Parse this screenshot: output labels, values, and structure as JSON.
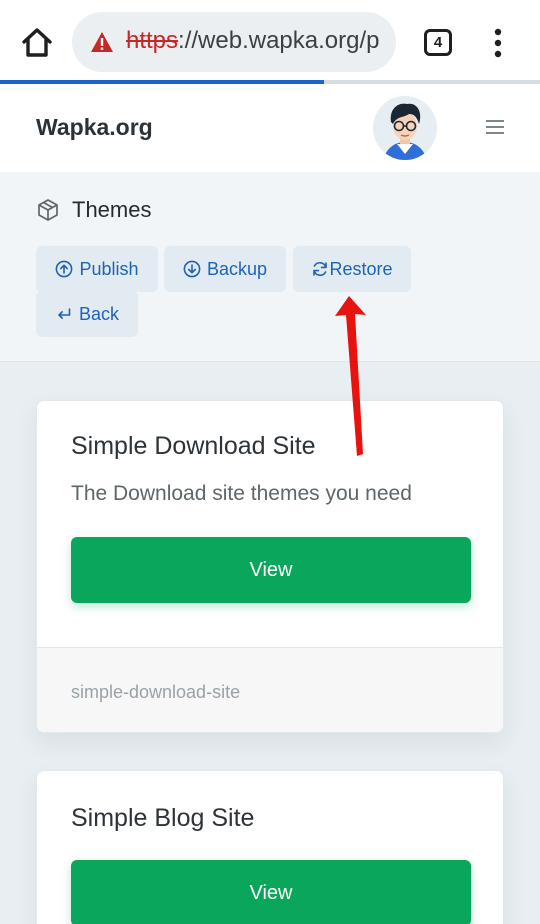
{
  "browser": {
    "url_scheme": "https",
    "url_rest": "://web.wapka.org/p",
    "tab_count": "4",
    "load_progress": 0.6
  },
  "header": {
    "brand": "Wapka.org"
  },
  "themes": {
    "title": "Themes",
    "actions": {
      "publish": "Publish",
      "backup": "Backup",
      "restore": "Restore",
      "back": "Back"
    }
  },
  "cards": [
    {
      "title": "Simple Download Site",
      "description": "The Download site themes you need",
      "view_label": "View",
      "slug": "simple-download-site"
    },
    {
      "title": "Simple Blog Site",
      "view_label": "View"
    }
  ],
  "colors": {
    "accent": "#1d63b8",
    "view_button": "#0aa65c",
    "annotation": "#e8130f",
    "warning": "#c62828"
  },
  "icons": {
    "home": "home-icon",
    "warning": "warning-icon",
    "menu": "more-vert-icon",
    "hamburger": "hamburger-icon",
    "box": "box-icon",
    "publish": "arrow-up-circle-icon",
    "backup": "arrow-down-circle-icon",
    "restore": "refresh-icon",
    "back": "return-arrow-icon"
  }
}
